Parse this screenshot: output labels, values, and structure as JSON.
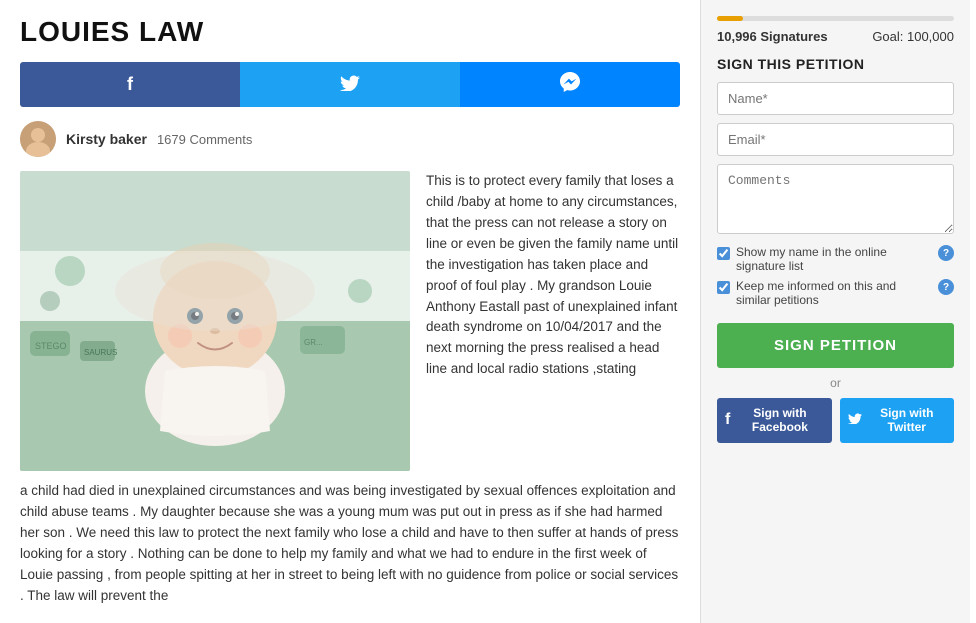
{
  "page": {
    "title": "LOUIES LAW"
  },
  "social_bar": {
    "facebook_icon": "f",
    "twitter_icon": "🐦",
    "messenger_icon": "💬"
  },
  "author": {
    "name": "Kirsty baker",
    "comments": "1679 Comments"
  },
  "article": {
    "text_col1": "This is to protect every family that loses a child /baby at home to any circumstances, that the press can not release a story on line or even be given the family name until the investigation has taken place and proof of foul play . My grandson Louie Anthony Eastall past of unexplained infant death syndrome on 10/04/2017 and the next morning the press realised a head line and local radio stations ,stating",
    "text_col2": "a child had died in unexplained circumstances and was being investigated by sexual offences exploitation and child abuse teams . My daughter because she was a young mum was put out in press as if she had harmed her son . We need this law to protect the next family who lose a child and have to then suffer at hands of press looking for a story . Nothing can be done to help my family and what we had to endure in the first week of Louie passing , from people spitting at her in street to being left with no guidence from police or social services . The law will prevent the"
  },
  "sidebar": {
    "signatures_count": "10,996 Signatures",
    "goal_label": "Goal: 100,000",
    "progress_percent": 11,
    "form_title": "SIGN THIS PETITION",
    "name_placeholder": "Name*",
    "email_placeholder": "Email*",
    "comments_placeholder": "Comments",
    "checkbox1_label": "Show my name in the online signature list",
    "checkbox2_label": "Keep me informed on this and similar petitions",
    "sign_btn_label": "SIGN PETITION",
    "or_text": "or",
    "facebook_sign_label": "Sign with Facebook",
    "twitter_sign_label": "Sign with Twitter"
  }
}
